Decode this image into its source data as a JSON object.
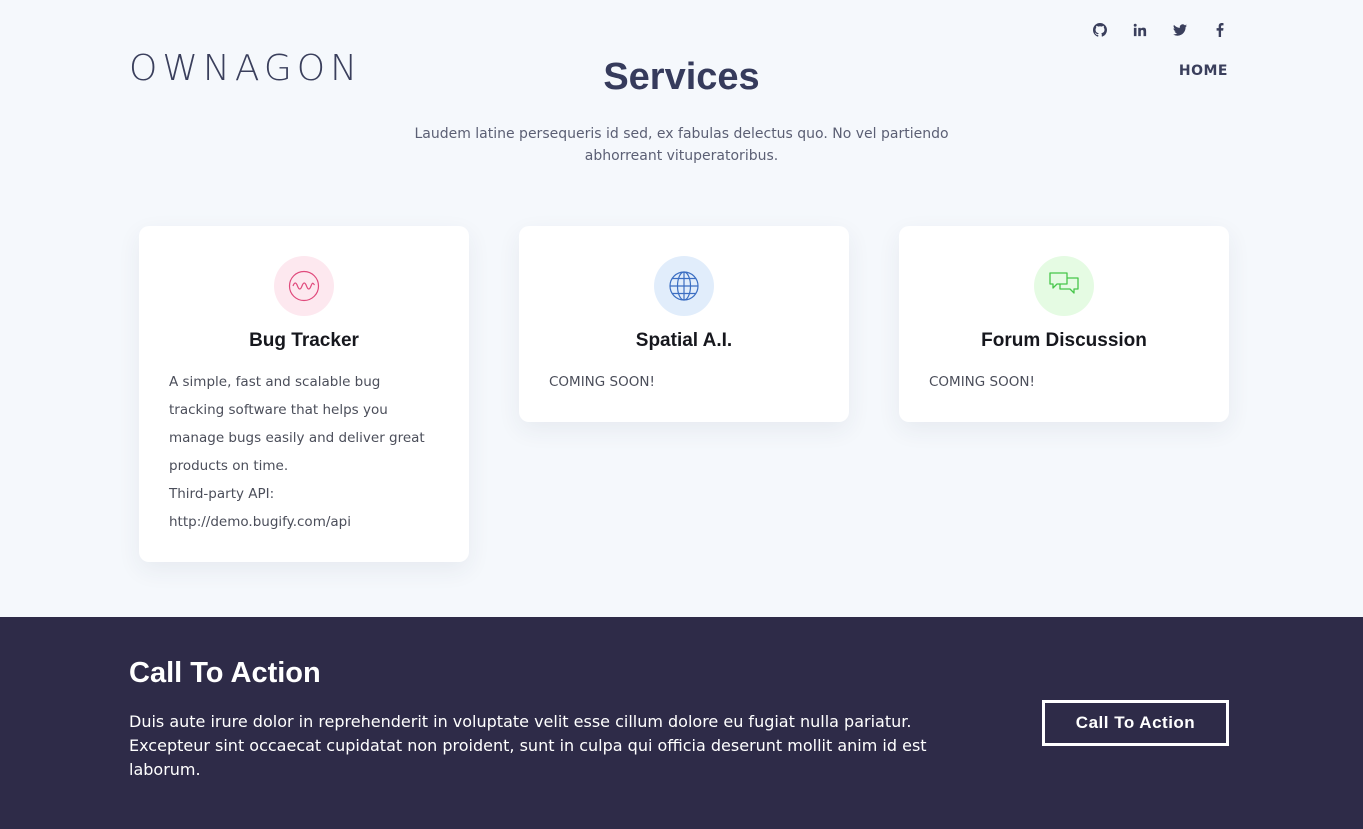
{
  "header": {
    "logo": "OWNAGON",
    "nav_home": "HOME",
    "social": [
      {
        "icon": "github-icon"
      },
      {
        "icon": "linkedin-icon"
      },
      {
        "icon": "twitter-icon"
      },
      {
        "icon": "facebook-icon"
      }
    ]
  },
  "services": {
    "title": "Services",
    "subtitle": "Laudem latine persequeris id sed, ex fabulas delectus quo. No vel partiendo abhorreant vituperatoribus.",
    "cards": [
      {
        "icon": "waveform-icon",
        "icon_bg": "#fde8ef",
        "icon_color": "#e04a7c",
        "title": "Bug Tracker",
        "lines": [
          "A simple, fast and scalable bug tracking software that helps you manage bugs easily and deliver great products on time.",
          "Third-party API: http://demo.bugify.com/api"
        ]
      },
      {
        "icon": "globe-icon",
        "icon_bg": "#e1edfb",
        "icon_color": "#3b6ec2",
        "title": "Spatial A.I.",
        "lines": [
          "COMING SOON!"
        ]
      },
      {
        "icon": "chat-bubbles-icon",
        "icon_bg": "#e5fbe3",
        "icon_color": "#46c64a",
        "title": "Forum Discussion",
        "lines": [
          "COMING SOON!"
        ]
      }
    ]
  },
  "cta": {
    "title": "Call To Action",
    "text": "Duis aute irure dolor in reprehenderit in voluptate velit esse cillum dolore eu fugiat nulla pariatur. Excepteur sint occaecat cupidatat non proident, sunt in culpa qui officia deserunt mollit anim id est laborum.",
    "button_label": "Call To Action",
    "bg_color": "#2e2b48"
  }
}
